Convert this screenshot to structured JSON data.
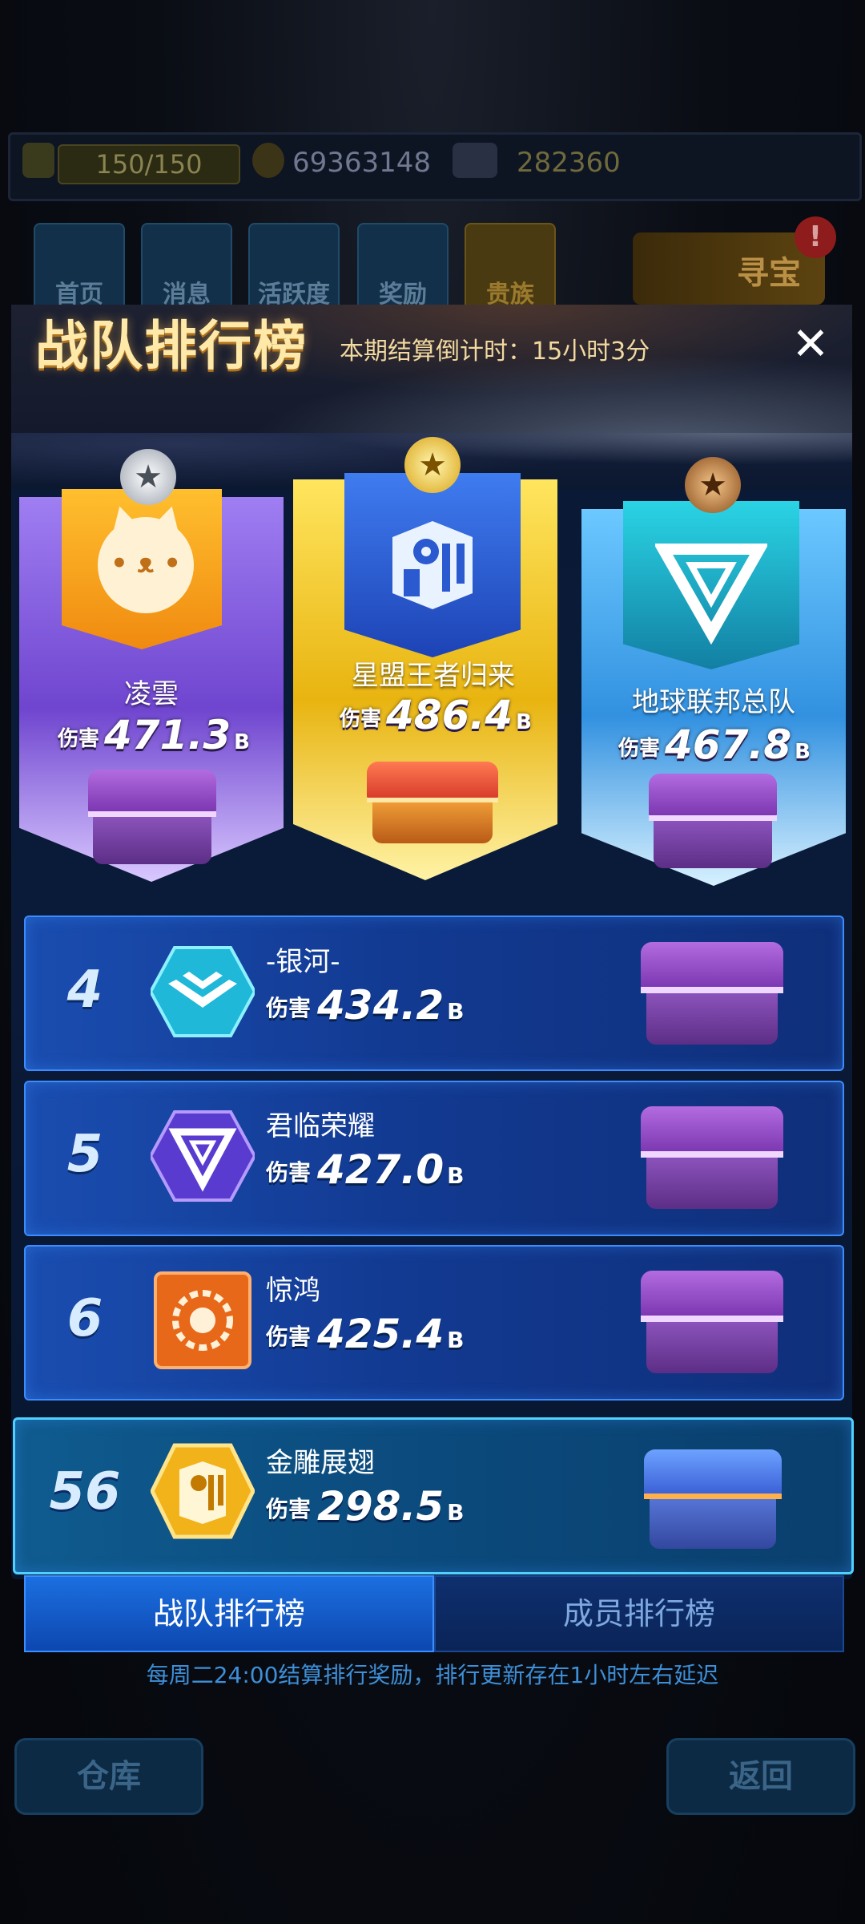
{
  "resources": {
    "energy": "150/150",
    "gold": "69363148",
    "crystals": "282360"
  },
  "nav": {
    "home": "首页",
    "messages": "消息",
    "activity": "活跃度",
    "rewards": "奖励",
    "noble": "贵族",
    "treasure": "寻宝",
    "treasure_badge": "!"
  },
  "panel": {
    "title": "战队排行榜",
    "countdown": "本期结算倒计时：15小时3分",
    "close_icon": "close-icon"
  },
  "damage_label": "伤害",
  "podium": [
    {
      "rank": 2,
      "medal": "silver",
      "name": "凌雲",
      "damage": "471.3",
      "unit": "B",
      "chest": "purple"
    },
    {
      "rank": 1,
      "medal": "gold",
      "name": "星盟王者归来",
      "damage": "486.4",
      "unit": "B",
      "chest": "red"
    },
    {
      "rank": 3,
      "medal": "bronze",
      "name": "地球联邦总队",
      "damage": "467.8",
      "unit": "B",
      "chest": "purple"
    }
  ],
  "rows": [
    {
      "rank": "4",
      "name": "-银河-",
      "damage": "434.2",
      "unit": "B",
      "chest": "purple"
    },
    {
      "rank": "5",
      "name": "君临荣耀",
      "damage": "427.0",
      "unit": "B",
      "chest": "purple"
    },
    {
      "rank": "6",
      "name": "惊鸿",
      "damage": "425.4",
      "unit": "B",
      "chest": "purple"
    }
  ],
  "my_team": {
    "rank": "56",
    "name": "金雕展翅",
    "damage": "298.5",
    "unit": "B",
    "chest": "blue"
  },
  "tabs": {
    "team": "战队排行榜",
    "member": "成员排行榜"
  },
  "notice": "每周二24:00结算排行奖励，排行更新存在1小时左右延迟",
  "bottom_buttons": {
    "warehouse": "仓库",
    "back": "返回"
  },
  "colors": {
    "gold_title": "#ffe9a8",
    "row_blue": "#1a4db0",
    "row_border": "#3b8cff",
    "podium_purple": "#6f45cf",
    "podium_gold": "#e8b410",
    "podium_blue": "#3291e0"
  }
}
